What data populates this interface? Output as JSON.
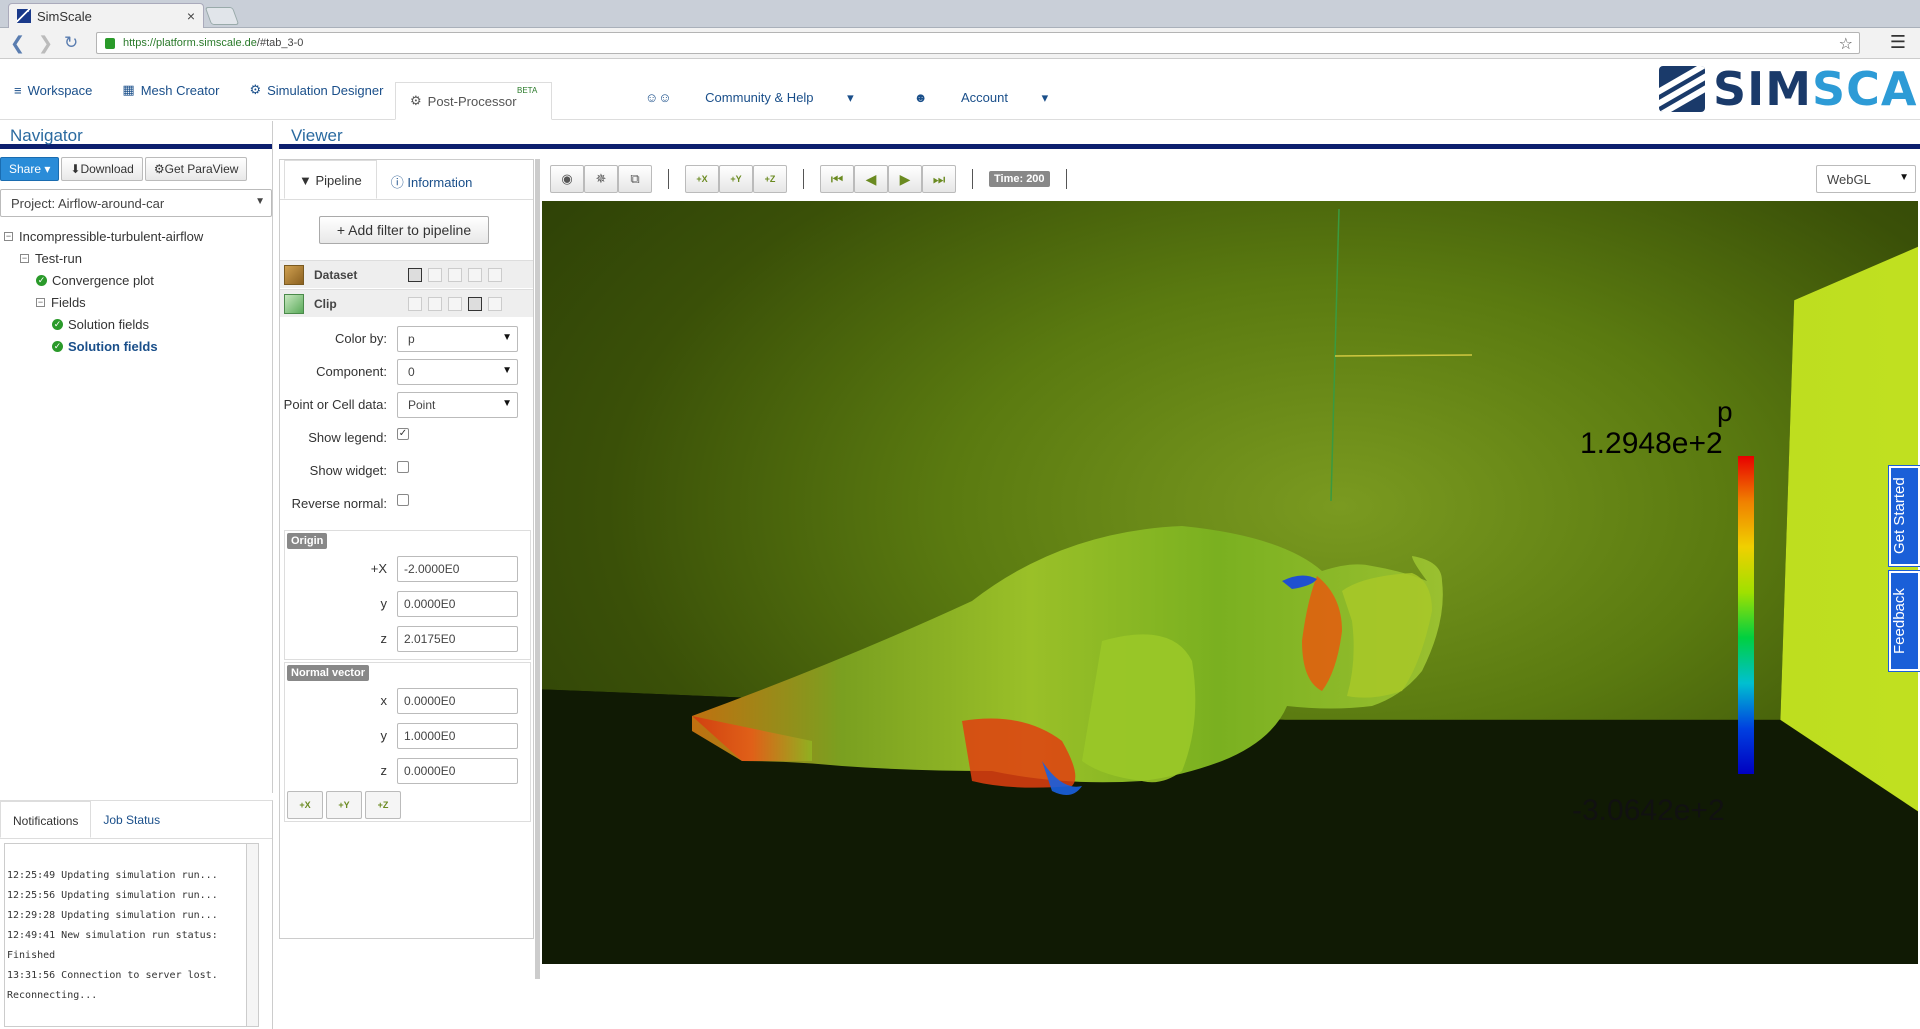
{
  "browser": {
    "tab_title": "SimScale",
    "tab_close": "×",
    "url_scheme_host": "https://platform.simscale.de",
    "url_path": "/#tab_3-0"
  },
  "appnav": {
    "workspace": "Workspace",
    "mesh_creator": "Mesh Creator",
    "simulation_designer": "Simulation Designer",
    "post_processor": "Post-Processor",
    "beta": "BETA",
    "community": "Community & Help",
    "account": "Account",
    "logo_a": "SIM",
    "logo_b": "SCALE"
  },
  "navigator": {
    "title": "Navigator",
    "share": "Share",
    "download": "Download",
    "paraview": "Get ParaView",
    "project": "Project: Airflow-around-car",
    "tree": {
      "root": "Incompressible-turbulent-airflow",
      "run": "Test-run",
      "convergence": "Convergence plot",
      "fields": "Fields",
      "sol1": "Solution fields",
      "sol2": "Solution fields"
    }
  },
  "notifications": {
    "tab_notifications": "Notifications",
    "tab_job_status": "Job Status",
    "log": [
      "12:25:49 Updating simulation run...",
      "12:25:56 Updating simulation run...",
      "12:29:28 Updating simulation run...",
      "12:49:41 New simulation run status:",
      "Finished",
      "13:31:56 Connection to server lost.",
      "Reconnecting..."
    ]
  },
  "viewer": {
    "title": "Viewer",
    "tab_pipeline": "Pipeline",
    "tab_information": "Information",
    "add_filter": "Add filter to pipeline",
    "dataset": "Dataset",
    "clip": "Clip",
    "color_by_label": "Color by:",
    "color_by_value": "p",
    "component_label": "Component:",
    "component_value": "0",
    "point_cell_label": "Point or Cell data:",
    "point_cell_value": "Point",
    "show_legend_label": "Show legend:",
    "show_legend_checked": true,
    "show_widget_label": "Show widget:",
    "show_widget_checked": false,
    "reverse_normal_label": "Reverse normal:",
    "reverse_normal_checked": false,
    "origin": {
      "title": "Origin",
      "x": "-2.0000E0",
      "y": "0.0000E0",
      "z": "2.0175E0"
    },
    "normal": {
      "title": "Normal vector",
      "x": "0.0000E0",
      "y": "1.0000E0",
      "z": "0.0000E0"
    },
    "axes": {
      "x": "+X",
      "y": "+Y",
      "z": "+Z"
    },
    "time_label": "Time: 200",
    "renderer": "WebGL",
    "legend": {
      "title": "p",
      "max": "1.2948e+2",
      "min": "-3.0642e+2"
    },
    "get_started": "Get Started",
    "feedback": "Feedback"
  },
  "colors": {
    "brand_dark": "#1a3a6a",
    "brand_light": "#2d9bd6",
    "accent_blue": "#1a5fd8",
    "link": "#1a4f8a",
    "panel_rule": "#0c1f6e"
  }
}
